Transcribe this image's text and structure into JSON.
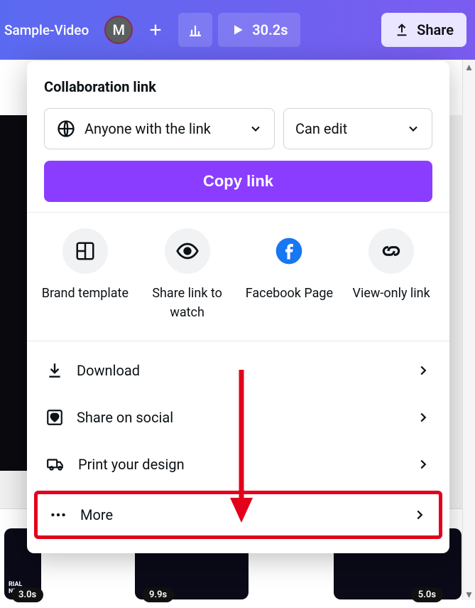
{
  "header": {
    "doc_title": "Sample-Video",
    "avatar_letter": "M",
    "duration": "30.2s",
    "share_label": "Share"
  },
  "panel": {
    "title": "Collaboration link",
    "access_label": "Anyone with the link",
    "permission_label": "Can edit",
    "copy_button": "Copy link"
  },
  "share_options": [
    {
      "label": "Brand template",
      "icon": "template-icon"
    },
    {
      "label": "Share link to watch",
      "icon": "eye-icon"
    },
    {
      "label": "Facebook Page",
      "icon": "facebook-icon"
    },
    {
      "label": "View-only link",
      "icon": "link-icon"
    }
  ],
  "actions": [
    {
      "label": "Download",
      "icon": "download-icon"
    },
    {
      "label": "Share on social",
      "icon": "heart-square-icon"
    },
    {
      "label": "Print your design",
      "icon": "truck-icon"
    },
    {
      "label": "More",
      "icon": "more-icon",
      "highlight": true
    }
  ],
  "timeline": {
    "badges": [
      "3.0s",
      "9.9s",
      "5.0s"
    ]
  }
}
